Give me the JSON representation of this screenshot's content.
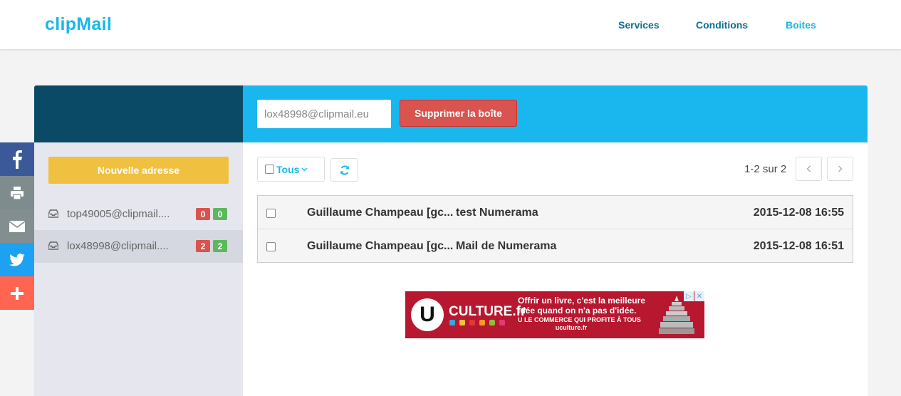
{
  "header": {
    "logo": "clipMail",
    "nav": [
      "Services",
      "Conditions",
      "Boites"
    ],
    "active_nav": "Boites"
  },
  "social": [
    "facebook-icon",
    "print-icon",
    "mail-icon",
    "twitter-icon",
    "plus-icon"
  ],
  "toolbar": {
    "address_value": "lox48998@clipmail.eu",
    "delete_label": "Supprimer la boîte"
  },
  "sidebar": {
    "new_label": "Nouvelle adresse",
    "boxes": [
      {
        "address": "top49005@clipmail....",
        "unread": "0",
        "total": "0"
      },
      {
        "address": "lox48998@clipmail....",
        "unread": "2",
        "total": "2"
      }
    ]
  },
  "list_controls": {
    "filter_label": "Tous",
    "pager_text": "1-2 sur 2"
  },
  "messages": [
    {
      "from": "Guillaume Champeau [gc...",
      "subject": "test Numerama",
      "date": "2015-12-08 16:55"
    },
    {
      "from": "Guillaume Champeau [gc...",
      "subject": "Mail de Numerama",
      "date": "2015-12-08 16:51"
    }
  ],
  "ad": {
    "brand": "CULTURE.fr",
    "line1": "Offrir un livre, c'est la meilleure",
    "line2": "idée quand on n'a pas d'idée.",
    "line3": "U LE COMMERCE QUI PROFITE À TOUS",
    "line4": "uculture.fr"
  },
  "colors": {
    "accent": "#1ab7ee",
    "dark": "#0a4a66",
    "danger": "#d9534f",
    "warning": "#f0c040",
    "success": "#5cb85c"
  }
}
